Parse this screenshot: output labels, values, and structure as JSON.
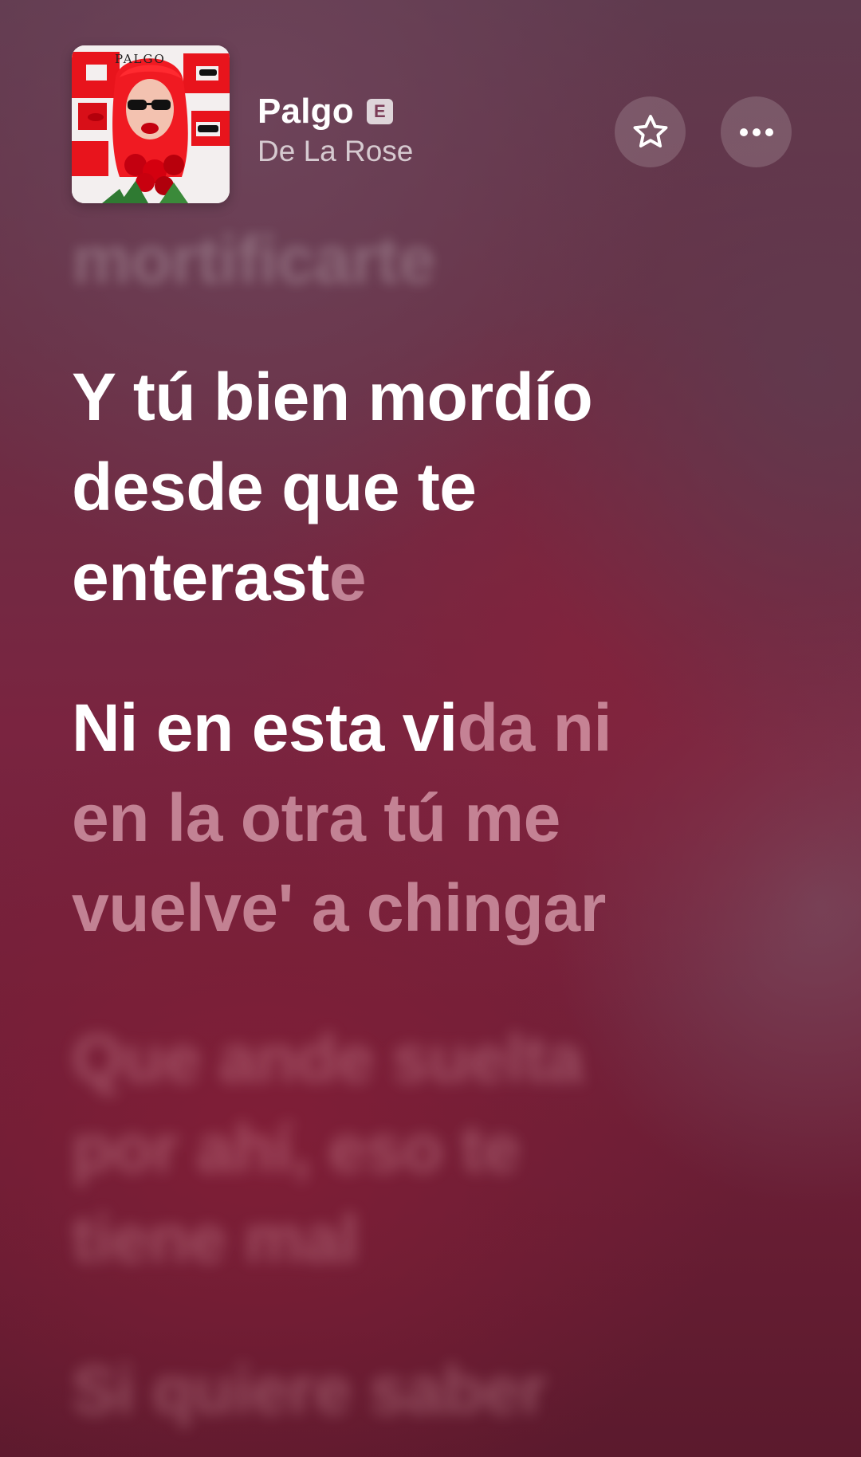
{
  "header": {
    "title": "Palgo",
    "explicit_badge": "E",
    "artist": "De La Rose",
    "album_art_text": "PALGO"
  },
  "actions": {
    "favorite_icon": "star-icon",
    "more_icon": "ellipsis-icon"
  },
  "lyrics": {
    "previous_line": "mortificarte",
    "line1": {
      "row1": "Y tú bien mordío",
      "row2": "desde que te",
      "row3_sung": "enterast",
      "row3_unsung": "e"
    },
    "line2": {
      "row1_sung": "Ni en esta vi",
      "row1_unsung": "da ni",
      "row2": "en la otra tú me",
      "row3": "vuelve' a chingar"
    },
    "next_line": {
      "row1": "Que ande suelta",
      "row2": "por ahí, eso te",
      "row3": "tiene mal"
    },
    "following_line": {
      "row1": "Si quiere saber"
    }
  },
  "colors": {
    "accent_red": "#e8141c",
    "sung_text": "#ffffff",
    "unsung_text": "#f2b6c4"
  }
}
